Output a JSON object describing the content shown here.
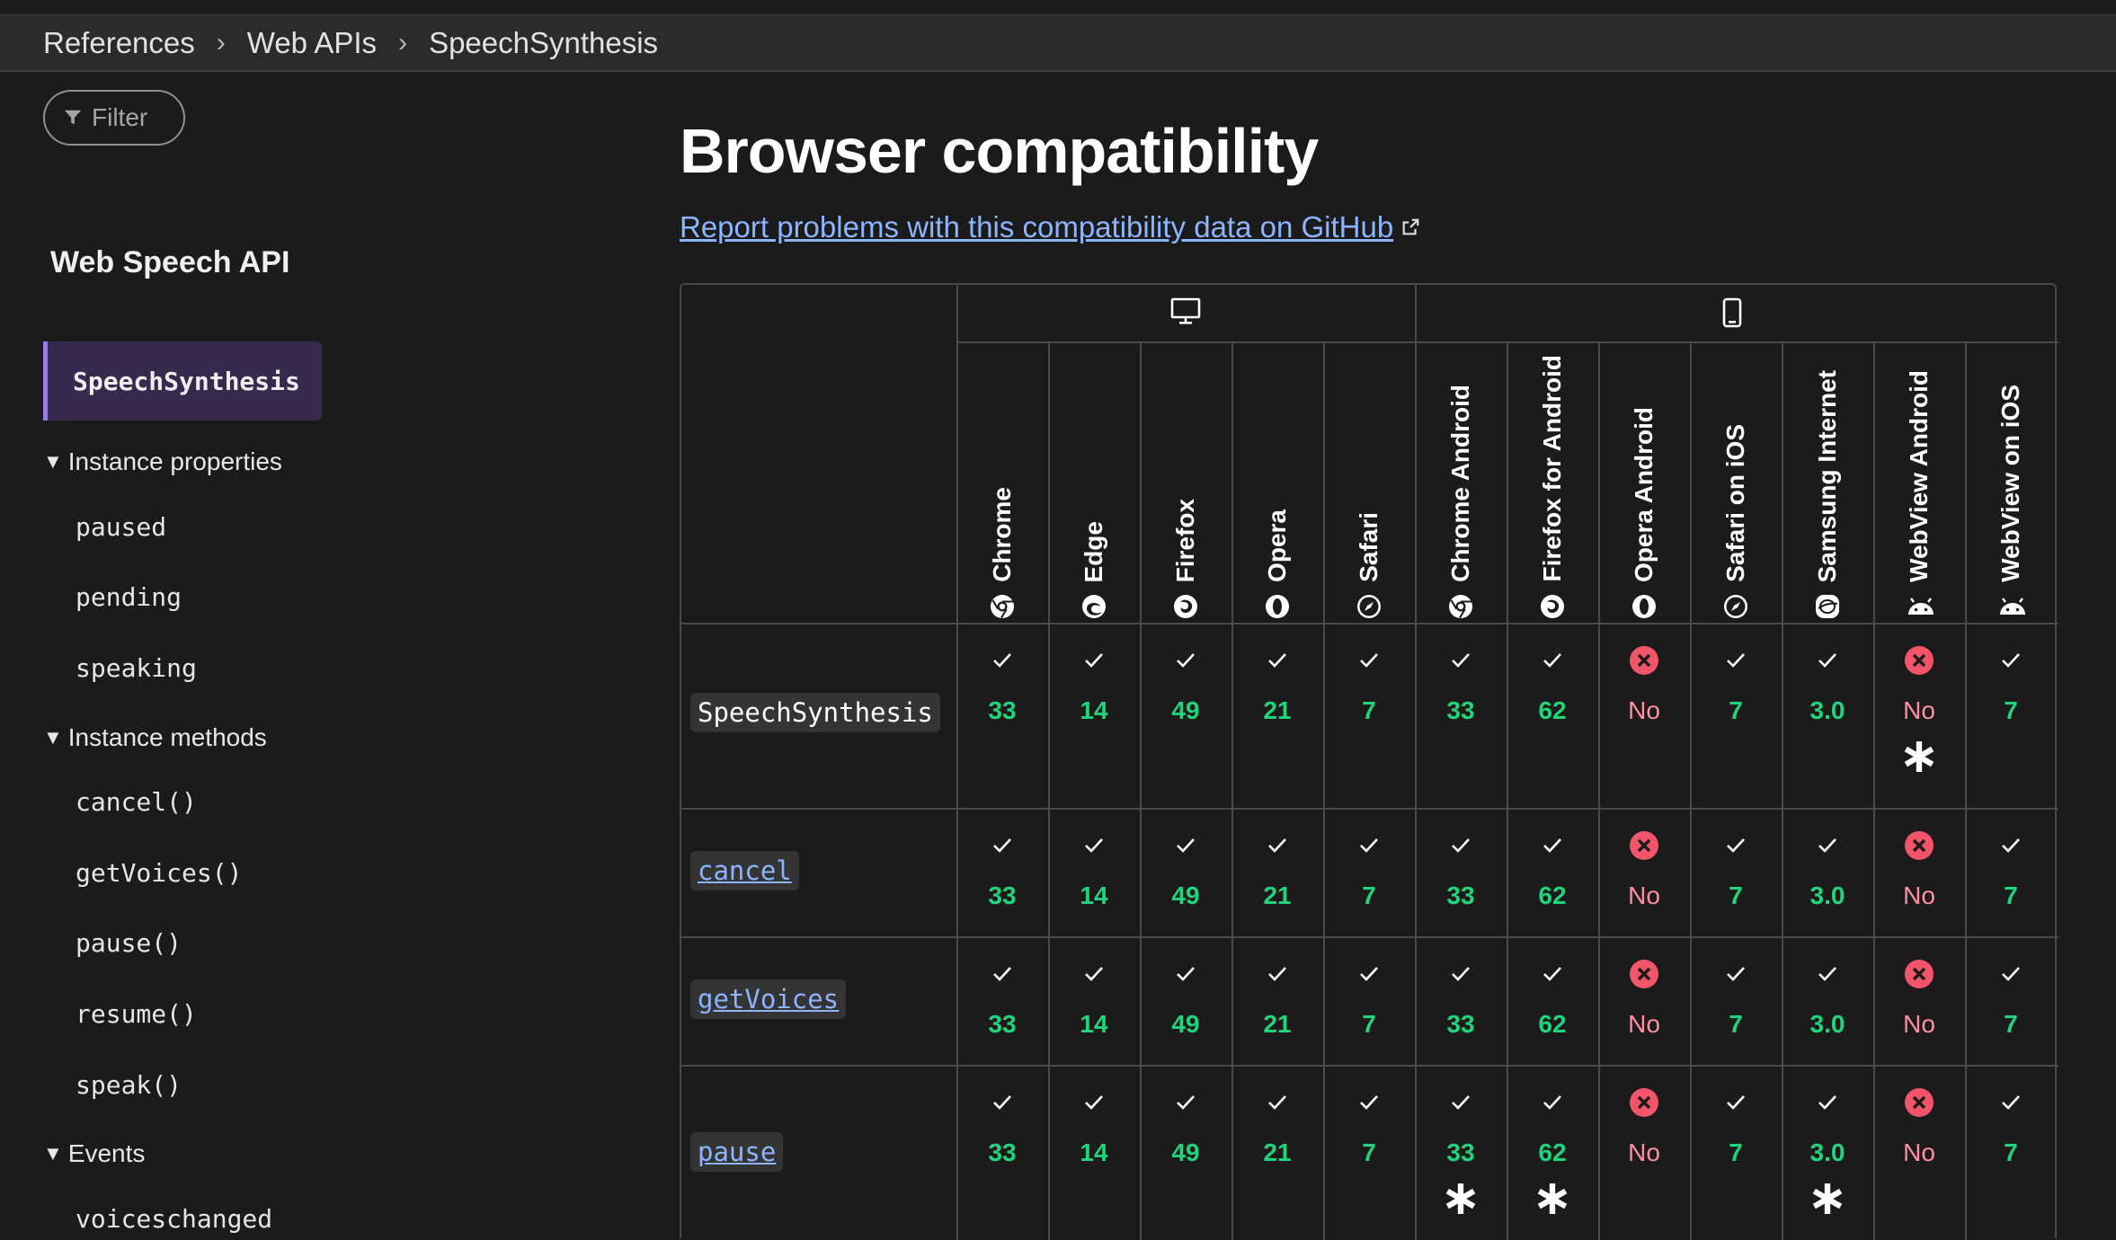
{
  "breadcrumb": [
    "References",
    "Web APIs",
    "SpeechSynthesis"
  ],
  "sidebar": {
    "filter_placeholder": "Filter",
    "title": "Web Speech API",
    "current": "SpeechSynthesis",
    "sections": [
      {
        "heading": "Instance properties",
        "items": [
          "paused",
          "pending",
          "speaking"
        ]
      },
      {
        "heading": "Instance methods",
        "items": [
          "cancel()",
          "getVoices()",
          "pause()",
          "resume()",
          "speak()"
        ]
      },
      {
        "heading": "Events",
        "items": [
          "voiceschanged"
        ]
      }
    ]
  },
  "main": {
    "title": "Browser compatibility",
    "report_link": "Report problems with this compatibility data on GitHub"
  },
  "compat": {
    "platforms": [
      {
        "name": "desktop",
        "icon": "desktop-icon"
      },
      {
        "name": "mobile",
        "icon": "mobile-icon"
      }
    ],
    "browsers": [
      {
        "name": "Chrome",
        "icon": "chrome-icon"
      },
      {
        "name": "Edge",
        "icon": "edge-icon"
      },
      {
        "name": "Firefox",
        "icon": "firefox-icon"
      },
      {
        "name": "Opera",
        "icon": "opera-icon"
      },
      {
        "name": "Safari",
        "icon": "safari-icon"
      },
      {
        "name": "Chrome Android",
        "icon": "chrome-icon"
      },
      {
        "name": "Firefox for Android",
        "icon": "firefox-icon"
      },
      {
        "name": "Opera Android",
        "icon": "opera-icon"
      },
      {
        "name": "Safari on iOS",
        "icon": "safari-icon"
      },
      {
        "name": "Samsung Internet",
        "icon": "samsung-icon"
      },
      {
        "name": "WebView Android",
        "icon": "android-icon"
      },
      {
        "name": "WebView on iOS",
        "icon": "android-icon"
      }
    ],
    "features": [
      {
        "name": "SpeechSynthesis",
        "link": false,
        "support": [
          {
            "v": "33",
            "ok": true
          },
          {
            "v": "14",
            "ok": true
          },
          {
            "v": "49",
            "ok": true
          },
          {
            "v": "21",
            "ok": true
          },
          {
            "v": "7",
            "ok": true
          },
          {
            "v": "33",
            "ok": true
          },
          {
            "v": "62",
            "ok": true
          },
          {
            "v": "No",
            "ok": false
          },
          {
            "v": "7",
            "ok": true
          },
          {
            "v": "3.0",
            "ok": true
          },
          {
            "v": "No",
            "ok": false,
            "note": true
          },
          {
            "v": "7",
            "ok": true
          }
        ]
      },
      {
        "name": "cancel",
        "link": true,
        "support": [
          {
            "v": "33",
            "ok": true
          },
          {
            "v": "14",
            "ok": true
          },
          {
            "v": "49",
            "ok": true
          },
          {
            "v": "21",
            "ok": true
          },
          {
            "v": "7",
            "ok": true
          },
          {
            "v": "33",
            "ok": true
          },
          {
            "v": "62",
            "ok": true
          },
          {
            "v": "No",
            "ok": false
          },
          {
            "v": "7",
            "ok": true
          },
          {
            "v": "3.0",
            "ok": true
          },
          {
            "v": "No",
            "ok": false
          },
          {
            "v": "7",
            "ok": true
          }
        ]
      },
      {
        "name": "getVoices",
        "link": true,
        "support": [
          {
            "v": "33",
            "ok": true
          },
          {
            "v": "14",
            "ok": true
          },
          {
            "v": "49",
            "ok": true
          },
          {
            "v": "21",
            "ok": true
          },
          {
            "v": "7",
            "ok": true
          },
          {
            "v": "33",
            "ok": true
          },
          {
            "v": "62",
            "ok": true
          },
          {
            "v": "No",
            "ok": false
          },
          {
            "v": "7",
            "ok": true
          },
          {
            "v": "3.0",
            "ok": true
          },
          {
            "v": "No",
            "ok": false
          },
          {
            "v": "7",
            "ok": true
          }
        ]
      },
      {
        "name": "pause",
        "link": true,
        "support": [
          {
            "v": "33",
            "ok": true
          },
          {
            "v": "14",
            "ok": true
          },
          {
            "v": "49",
            "ok": true
          },
          {
            "v": "21",
            "ok": true
          },
          {
            "v": "7",
            "ok": true
          },
          {
            "v": "33",
            "ok": true,
            "note": true
          },
          {
            "v": "62",
            "ok": true,
            "note": true
          },
          {
            "v": "No",
            "ok": false
          },
          {
            "v": "7",
            "ok": true
          },
          {
            "v": "3.0",
            "ok": true,
            "note": true
          },
          {
            "v": "No",
            "ok": false
          },
          {
            "v": "7",
            "ok": true
          }
        ]
      }
    ],
    "note_symbol": "∗",
    "colors": {
      "yes": "#1fd47a",
      "no": "#ff8fa0",
      "no_icon": "#f2546a",
      "link": "#8cb4ff",
      "accent": "#9b7cdf"
    }
  }
}
